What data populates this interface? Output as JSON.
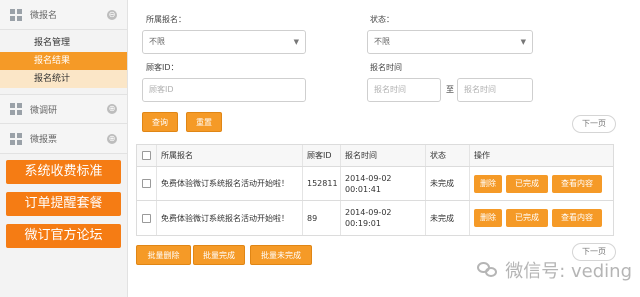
{
  "sidebar": {
    "sections": [
      {
        "label": "微报名",
        "toggle": "⊖"
      },
      {
        "label": "微调研",
        "toggle": "⊕"
      },
      {
        "label": "微报票",
        "toggle": "⊕"
      }
    ],
    "sub_items": [
      "报名管理",
      "报名结果",
      "报名统计"
    ],
    "promo_buttons": [
      "系统收费标准",
      "订单提醒套餐",
      "微订官方论坛"
    ]
  },
  "filters": {
    "activity_label": "所属报名：",
    "activity_value": "不限",
    "status_label": "状态：",
    "status_value": "不限",
    "customer_label": "顾客ID：",
    "customer_placeholder": "顾客ID",
    "time_label": "报名时间",
    "time_start_placeholder": "报名时间",
    "time_to": "至",
    "time_end_placeholder": "报名时间",
    "query_button": "查询",
    "clear_button": "重置"
  },
  "pager": {
    "next_top": "下一页",
    "next_bottom": "下一页"
  },
  "table": {
    "columns": [
      "所属报名",
      "顾客ID",
      "报名时间",
      "状态",
      "操作"
    ],
    "rows": [
      {
        "name": "免费体验微订系统报名活动开始啦！",
        "id": "152811",
        "date": "2014-09-02",
        "time": "00:01:41",
        "status": "未完成",
        "actions": [
          "删除",
          "已完成",
          "查看内容"
        ]
      },
      {
        "name": "免费体验微订系统报名活动开始啦！",
        "id": "89",
        "date": "2014-09-02",
        "time": "00:19:01",
        "status": "未完成",
        "actions": [
          "删除",
          "已完成",
          "查看内容"
        ]
      }
    ]
  },
  "bulk": [
    "批量删除",
    "批量完成",
    "批量未完成"
  ],
  "watermark": "微信号: veding"
}
